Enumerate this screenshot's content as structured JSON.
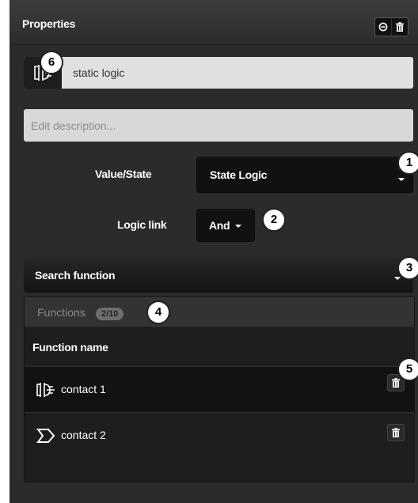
{
  "panel": {
    "title": "Properties",
    "header_buttons": [
      "collapse-icon",
      "trash-icon"
    ]
  },
  "name": {
    "icon": "logic-block-icon",
    "value": "static logic"
  },
  "description": {
    "placeholder": "Edit description..."
  },
  "value_state": {
    "label": "Value/State",
    "selected": "State Logic"
  },
  "logic_link": {
    "label": "Logic link",
    "selected": "And"
  },
  "search": {
    "label": "Search function"
  },
  "functions": {
    "title": "Functions",
    "count": "2/10",
    "column_header": "Function name",
    "items": [
      {
        "icon": "contact-icon",
        "label": "contact 1"
      },
      {
        "icon": "arrow-contact-icon",
        "label": "contact 2"
      }
    ]
  },
  "callouts": [
    "6",
    "1",
    "2",
    "3",
    "4",
    "5"
  ]
}
